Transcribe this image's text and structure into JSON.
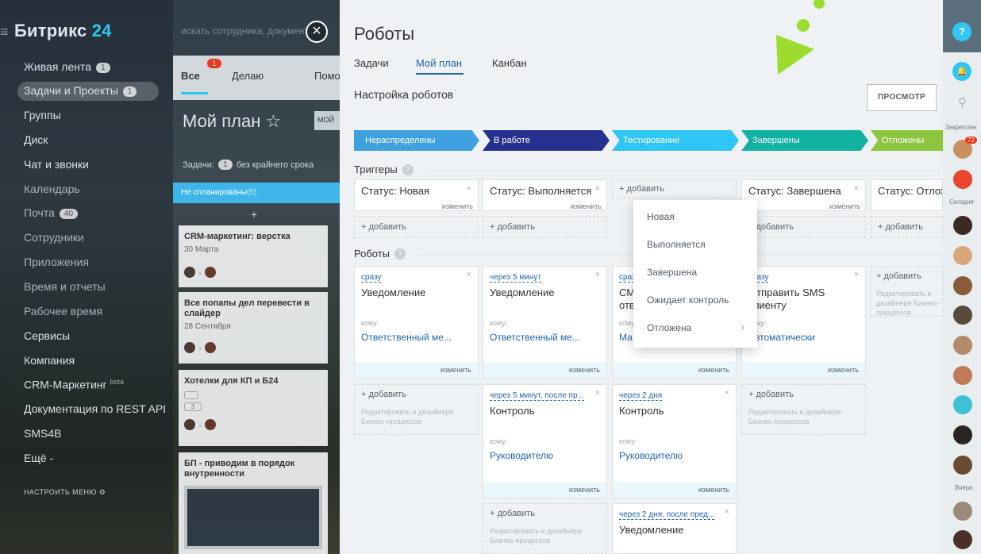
{
  "left_nav": {
    "logo_a": "Битрикс",
    "logo_b": "24",
    "search_placeholder": "искать сотрудника, документ...",
    "items": [
      {
        "label": "Живая лента",
        "count": "1"
      },
      {
        "label": "Задачи и Проекты",
        "count": "1"
      },
      {
        "label": "Группы"
      },
      {
        "label": "Диск"
      },
      {
        "label": "Чат и звонки"
      },
      {
        "label": "Календарь"
      },
      {
        "label": "Почта",
        "count": "40"
      },
      {
        "label": "Сотрудники"
      },
      {
        "label": "Приложения"
      },
      {
        "label": "Время и отчеты"
      },
      {
        "label": "Рабочее время"
      },
      {
        "label": "Сервисы"
      },
      {
        "label": "Компания"
      },
      {
        "label": "CRM-Маркетинг",
        "sup": "beta"
      },
      {
        "label": "Документация по REST API"
      },
      {
        "label": "SMS4B"
      },
      {
        "label": "Ещё -"
      }
    ],
    "configure_menu": "НАСТРОИТЬ МЕНЮ"
  },
  "tasks": {
    "tabs": [
      "Все",
      "Делаю",
      "Помогаю"
    ],
    "tab_badge": "1",
    "title": "Мой план ☆",
    "title_btn": "МОЙ",
    "filter_line": "Задачи:",
    "filter_count": "1",
    "filter_rest": "без крайнего срока",
    "column": "Не спланированы",
    "column_count": "(5)",
    "cards": [
      {
        "title": "CRM-маркетинг: верстка",
        "date": "30 Марта"
      },
      {
        "title": "Все попапы дел перевести в слайдер",
        "date": "28 Сентября"
      },
      {
        "title": "Хотелки для КП и Б24",
        "date": ""
      },
      {
        "title": "БП - приводим в порядок внутренности",
        "date": ""
      }
    ],
    "card3_badge": "3"
  },
  "panel": {
    "title": "Роботы",
    "tabs": [
      "Задачи",
      "Мой план",
      "Канбан"
    ],
    "active_tab": "Мой план",
    "subtitle": "Настройка роботов",
    "preview_btn": "ПРОСМОТР",
    "stages": [
      {
        "label": "Нераспределены",
        "color": "#3ea0df"
      },
      {
        "label": "В работе",
        "color": "#26318f"
      },
      {
        "label": "Тестирование",
        "color": "#2fc6f6"
      },
      {
        "label": "Завершены",
        "color": "#12b2a3"
      },
      {
        "label": "Отложены",
        "color": "#8cc63f"
      }
    ],
    "triggers_label": "Триггеры",
    "robots_label": "Роботы",
    "add": "+ добавить",
    "change": "изменить",
    "triggers": [
      "Статус: Новая",
      "Статус: Выполняется",
      "",
      "Статус: Завершена",
      "Статус: Отложена"
    ],
    "hint": "Редактировать в дизайнере Бизнес-процессов",
    "to_label": "кому:",
    "robots": {
      "c1r1": {
        "when": "сразу",
        "name": "Уведомление",
        "who": "Ответственный ме..."
      },
      "c2r1": {
        "when": "через 5 минут",
        "name": "Уведомление",
        "who": "Ответственный ме..."
      },
      "c3r1": {
        "when": "сразу",
        "name": "СМС отв.",
        "who": "Ма..."
      },
      "c4r1": {
        "when": "сразу",
        "name": "Отправить SMS клиенту",
        "who": "Автоматически"
      },
      "c2r2": {
        "when": "через 5 минут, после пр...",
        "name": "Контроль",
        "who": "Руководителю"
      },
      "c3r2": {
        "when": "через 2 дня",
        "name": "Контроль",
        "who": "Руководителю"
      },
      "c3r3": {
        "when": "через 2 дня, после пред...",
        "name": "Уведомление"
      }
    },
    "dropdown": [
      "Новая",
      "Выполняется",
      "Завершена",
      "Ожидает контроль",
      "Отложена"
    ]
  },
  "right_bar": {
    "help": "?",
    "pinned": "Закреплен",
    "badge": "72",
    "today": "Сегодня",
    "yesterday": "Вчера"
  }
}
